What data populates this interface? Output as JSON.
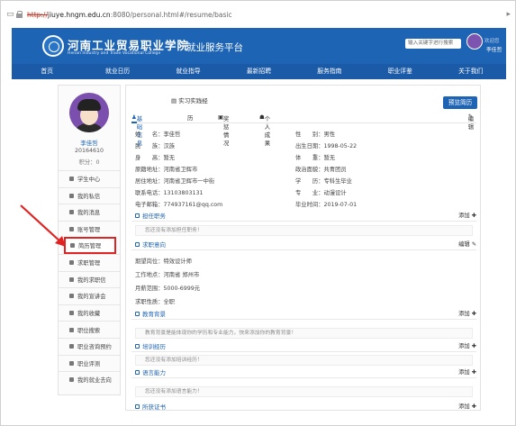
{
  "browser": {
    "scheme": "http://",
    "host": "jiuye.hngm.edu.cn",
    "path": ":8080/personal.html#/resume/basic"
  },
  "header": {
    "school_name": "河南工业贸易职业学院",
    "school_name_en": "Henan Industry and Trade Vocational College",
    "platform": "就业服务平台",
    "search_placeholder": "输入关键字进行搜索",
    "user_label": "欢迎您",
    "user_name": "李佳哲"
  },
  "nav": [
    "首页",
    "就业日历",
    "就业指导",
    "最新招聘",
    "服务指南",
    "职业评鉴",
    "关于我们"
  ],
  "sidebar": {
    "name": "李佳哲",
    "id": "20164610",
    "points": "积分：0",
    "menu": [
      {
        "label": "学生中心"
      },
      {
        "label": "我的私信"
      },
      {
        "label": "我的消息"
      },
      {
        "label": "账号管理"
      },
      {
        "label": "简历管理"
      },
      {
        "label": "求职管理"
      },
      {
        "label": "我的求职信"
      },
      {
        "label": "我的宣讲会"
      },
      {
        "label": "我的收藏"
      },
      {
        "label": "职位搜索"
      },
      {
        "label": "职业咨询预约"
      },
      {
        "label": "职业评测"
      },
      {
        "label": "我的就业去向"
      }
    ]
  },
  "main": {
    "top_tab": "实习实践经",
    "preview_button": "预览简历",
    "subtabs": {
      "basic": "基础信息",
      "edu": "历",
      "award": "奖惩情况",
      "achievement": "个人成果"
    },
    "edit": "编辑",
    "add": "添加",
    "basic": {
      "left": [
        {
          "k": "姓　　名：",
          "v": "李佳哲"
        },
        {
          "k": "民　　族：",
          "v": "汉族"
        },
        {
          "k": "身　　高：",
          "v": "暂无"
        },
        {
          "k": "原籍地址：",
          "v": "河南省卫辉市"
        },
        {
          "k": "居住地址：",
          "v": "河南省卫辉市一中街"
        },
        {
          "k": "联系电话：",
          "v": "13103803131"
        },
        {
          "k": "电子邮箱：",
          "v": "774937161@qq.com"
        }
      ],
      "right": [
        {
          "k": "性　　别：",
          "v": "男性"
        },
        {
          "k": "出生日期：",
          "v": "1998-05-22"
        },
        {
          "k": "体　　重：",
          "v": "暂无"
        },
        {
          "k": "政治面貌：",
          "v": "共青团员"
        },
        {
          "k": "学　　历：",
          "v": "专科生毕业"
        },
        {
          "k": "专　　业：",
          "v": "动漫设计"
        },
        {
          "k": "毕业时间：",
          "v": "2019-07-01"
        }
      ]
    },
    "position": {
      "title": "担任职务",
      "empty": "您还没有添加担任职务！"
    },
    "intent": {
      "title": "求职意向",
      "items": [
        {
          "k": "期望岗位：",
          "v": "特效设计师"
        },
        {
          "k": "工作地点：",
          "v": "河南省 郑州市"
        },
        {
          "k": "月薪范围：",
          "v": "5000-6999元"
        },
        {
          "k": "求职性质：",
          "v": "全职"
        }
      ]
    },
    "education": {
      "title": "教育背景",
      "empty": "教育背景是能体现你的学历和专业能力，快来添加你的教育背景！"
    },
    "training": {
      "title": "培训经历",
      "empty": "您还没有添加培训经历！"
    },
    "language": {
      "title": "语言能力",
      "empty": "您还没有添加语言能力！"
    },
    "certificate": {
      "title": "所获证书"
    }
  },
  "colors": {
    "brand": "#1e64b4",
    "highlight": "#e02424",
    "avatar": "#7b4fae"
  }
}
